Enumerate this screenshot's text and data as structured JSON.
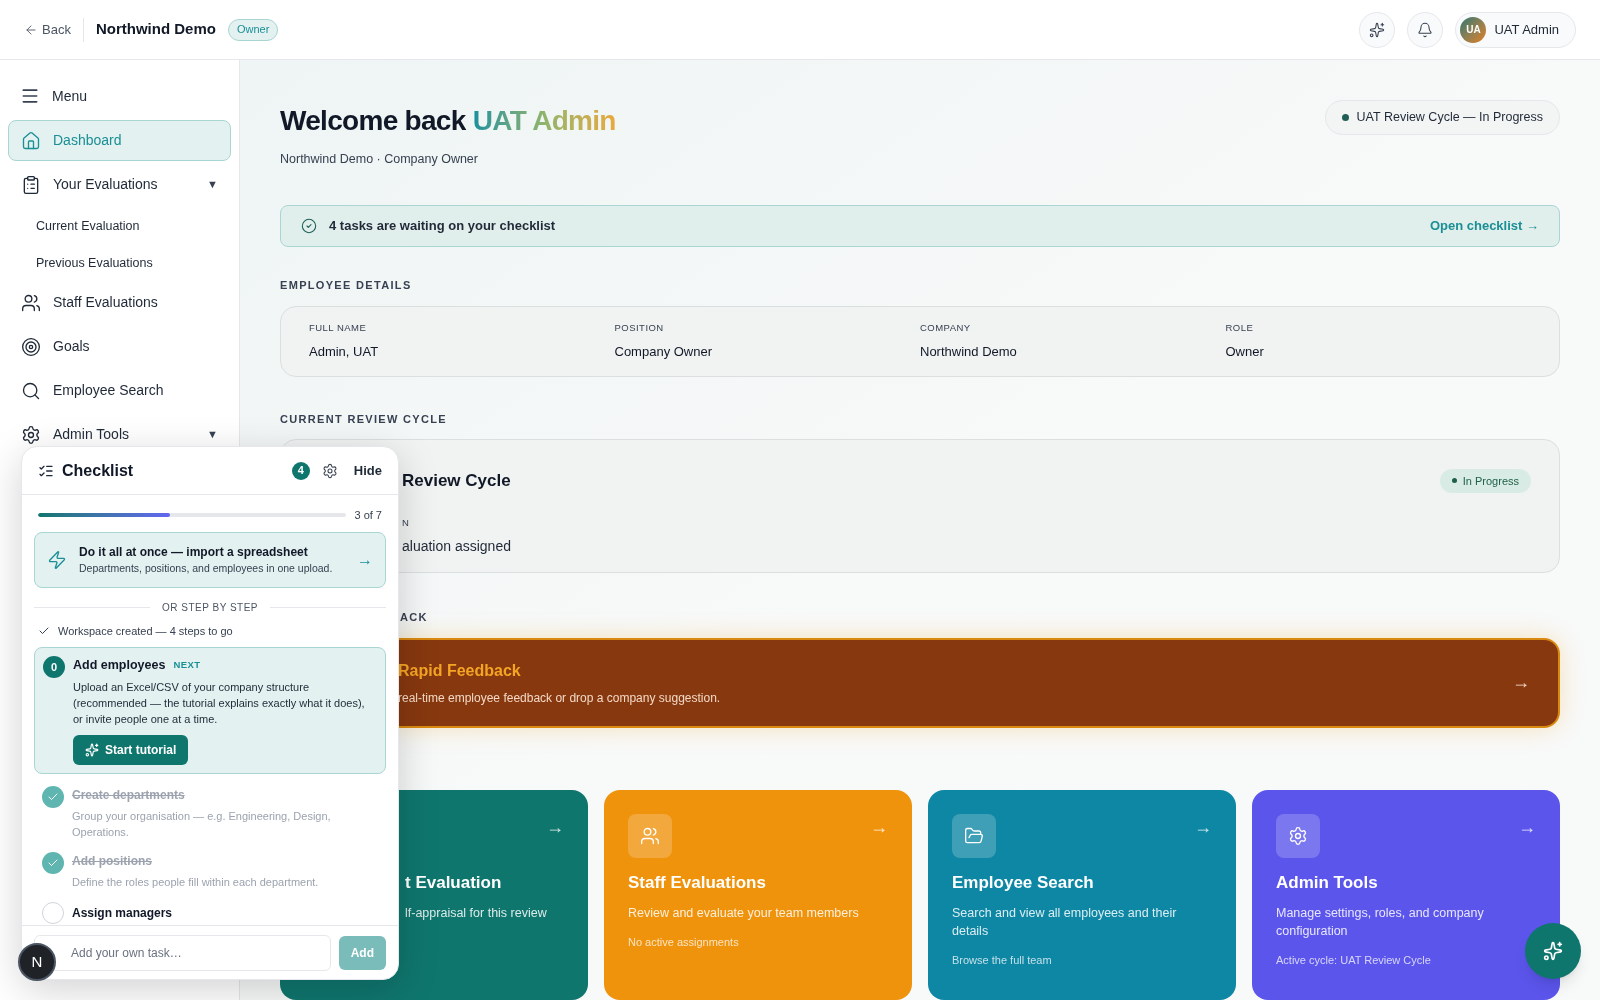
{
  "topbar": {
    "back": "Back",
    "company": "Northwind Demo",
    "role_badge": "Owner",
    "user": {
      "initials": "UA",
      "name": "UAT Admin"
    }
  },
  "sidebar": {
    "menu_label": "Menu",
    "items": [
      {
        "label": "Dashboard",
        "selected": true
      },
      {
        "label": "Your Evaluations",
        "selected": false,
        "caret": "▼",
        "children": [
          {
            "label": "Current Evaluation",
            "selected": false
          },
          {
            "label": "Previous Evaluations",
            "selected": false
          }
        ]
      },
      {
        "label": "Staff Evaluations",
        "selected": false
      },
      {
        "label": "Goals",
        "selected": false
      },
      {
        "label": "Employee Search",
        "selected": false
      },
      {
        "label": "Admin Tools",
        "selected": false,
        "caret": "▼"
      }
    ]
  },
  "welcome": {
    "prefix": "Welcome back",
    "name": "UAT Admin",
    "subtitle": "Northwind Demo · Company Owner"
  },
  "cycle_pill": "UAT Review Cycle — In Progress",
  "banner": {
    "text": "4 tasks are waiting on your checklist",
    "link": "Open checklist →"
  },
  "employee_details": {
    "heading": "EMPLOYEE DETAILS",
    "fields": [
      {
        "label": "FULL NAME",
        "value": "Admin, UAT"
      },
      {
        "label": "POSITION",
        "value": "Company Owner"
      },
      {
        "label": "COMPANY",
        "value": "Northwind Demo"
      },
      {
        "label": "ROLE",
        "value": "Owner"
      }
    ]
  },
  "review_cycle": {
    "heading": "CURRENT REVIEW CYCLE",
    "title": "Review Cycle",
    "status": "In Progress",
    "field_label": "N",
    "field_value": "aluation assigned"
  },
  "rapid_feedback": {
    "heading": "ACK",
    "title": "Rapid Feedback",
    "description": "real-time employee feedback or drop a company suggestion.",
    "arrow": "→"
  },
  "cards": [
    {
      "title": "t Evaluation",
      "description": "lf-appraisal for this review",
      "arrow": "→",
      "color": "#0f766e"
    },
    {
      "title": "Staff Evaluations",
      "description": "Review and evaluate your team members",
      "footer": "No active assignments",
      "arrow": "→",
      "color": "#ef930c"
    },
    {
      "title": "Employee Search",
      "description": "Search and view all employees and their details",
      "footer": "Browse the full team",
      "arrow": "→",
      "color": "#0e87a5"
    },
    {
      "title": "Admin Tools",
      "description": "Manage settings, roles, and company configuration",
      "footer": "Active cycle: UAT Review Cycle",
      "arrow": "→",
      "color": "#5b55ec"
    }
  ],
  "checklist": {
    "title": "Checklist",
    "count": "4",
    "hide": "Hide",
    "progress": {
      "level": 0.4286,
      "label": "3 of 7"
    },
    "import": {
      "title": "Do it all at once — import a spreadsheet",
      "description": "Departments, positions, and employees in one upload.",
      "arrow": "→"
    },
    "divider": "OR STEP BY STEP",
    "summary": "Workspace created — 4 steps to go",
    "steps": [
      {
        "kind": "next",
        "number": "0",
        "title": "Add employees",
        "tag": "NEXT",
        "description": "Upload an Excel/CSV of your company structure (recommended — the tutorial explains exactly what it does), or invite people one at a time.",
        "button": "Start tutorial"
      },
      {
        "kind": "done",
        "title": "Create departments",
        "description": "Group your organisation — e.g. Engineering, Design, Operations."
      },
      {
        "kind": "done",
        "title": "Add positions",
        "description": "Define the roles people fill within each department."
      },
      {
        "kind": "todo",
        "title": "Assign managers"
      }
    ],
    "add_task": {
      "placeholder": "Add your own task…",
      "button": "Add"
    }
  },
  "dev_badge": "N"
}
